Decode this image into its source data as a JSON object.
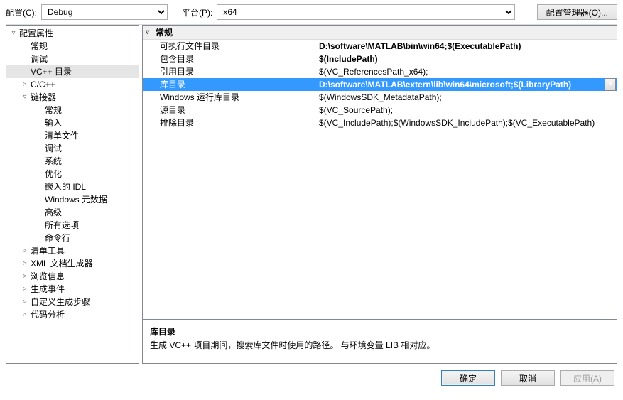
{
  "toolbar": {
    "config_label": "配置(C):",
    "config_value": "Debug",
    "platform_label": "平台(P):",
    "platform_value": "x64",
    "manager_button": "配置管理器(O)..."
  },
  "tree": [
    {
      "label": "配置属性",
      "depth": 0,
      "arrow": "▿",
      "expanded": true
    },
    {
      "label": "常规",
      "depth": 1,
      "arrow": ""
    },
    {
      "label": "调试",
      "depth": 1,
      "arrow": ""
    },
    {
      "label": "VC++ 目录",
      "depth": 1,
      "arrow": "",
      "selected": true
    },
    {
      "label": "C/C++",
      "depth": 1,
      "arrow": "▹"
    },
    {
      "label": "链接器",
      "depth": 1,
      "arrow": "▿"
    },
    {
      "label": "常规",
      "depth": 2,
      "arrow": ""
    },
    {
      "label": "输入",
      "depth": 2,
      "arrow": ""
    },
    {
      "label": "清单文件",
      "depth": 2,
      "arrow": ""
    },
    {
      "label": "调试",
      "depth": 2,
      "arrow": ""
    },
    {
      "label": "系统",
      "depth": 2,
      "arrow": ""
    },
    {
      "label": "优化",
      "depth": 2,
      "arrow": ""
    },
    {
      "label": "嵌入的 IDL",
      "depth": 2,
      "arrow": ""
    },
    {
      "label": "Windows 元数据",
      "depth": 2,
      "arrow": ""
    },
    {
      "label": "高级",
      "depth": 2,
      "arrow": ""
    },
    {
      "label": "所有选项",
      "depth": 2,
      "arrow": ""
    },
    {
      "label": "命令行",
      "depth": 2,
      "arrow": ""
    },
    {
      "label": "清单工具",
      "depth": 1,
      "arrow": "▹"
    },
    {
      "label": "XML 文档生成器",
      "depth": 1,
      "arrow": "▹"
    },
    {
      "label": "浏览信息",
      "depth": 1,
      "arrow": "▹"
    },
    {
      "label": "生成事件",
      "depth": 1,
      "arrow": "▹"
    },
    {
      "label": "自定义生成步骤",
      "depth": 1,
      "arrow": "▹"
    },
    {
      "label": "代码分析",
      "depth": 1,
      "arrow": "▹"
    }
  ],
  "section": {
    "arrow": "▿",
    "title": "常规"
  },
  "properties": [
    {
      "name": "可执行文件目录",
      "value": "D:\\software\\MATLAB\\bin\\win64;$(ExecutablePath)",
      "bold": true
    },
    {
      "name": "包含目录",
      "value": "$(IncludePath)",
      "bold": true
    },
    {
      "name": "引用目录",
      "value": "$(VC_ReferencesPath_x64);"
    },
    {
      "name": "库目录",
      "value": "D:\\software\\MATLAB\\extern\\lib\\win64\\microsoft;$(LibraryPath)",
      "selected": true,
      "dropdown": true
    },
    {
      "name": "Windows 运行库目录",
      "value": "$(WindowsSDK_MetadataPath);"
    },
    {
      "name": "源目录",
      "value": "$(VC_SourcePath);"
    },
    {
      "name": "排除目录",
      "value": "$(VC_IncludePath);$(WindowsSDK_IncludePath);$(VC_ExecutablePath)"
    }
  ],
  "help": {
    "title": "库目录",
    "desc": "生成 VC++ 项目期间，搜索库文件时使用的路径。    与环境变量 LIB 相对应。"
  },
  "buttons": {
    "ok": "确定",
    "cancel": "取消",
    "apply": "应用(A)"
  }
}
